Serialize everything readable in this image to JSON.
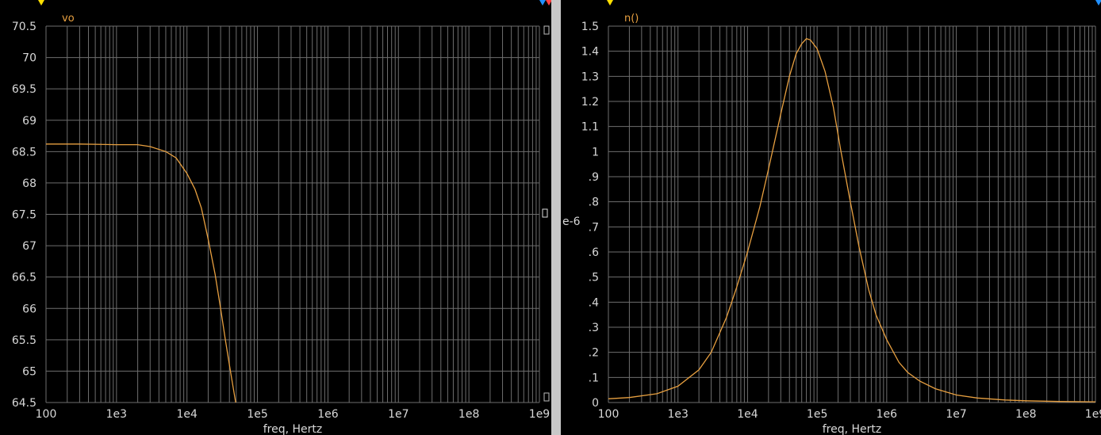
{
  "colors": {
    "background": "#000000",
    "grid": "#6e6e6e",
    "tick_text": "#d8d8d8",
    "trace": "#e8a040",
    "trace_label": "#e8a040",
    "marker_yellow": "#ffe000",
    "marker_blue": "#2090ff",
    "marker_red": "#ff4040"
  },
  "chart_data": [
    {
      "type": "line",
      "title": "",
      "trace_label": "vo",
      "xlabel": "freq, Hertz",
      "ylabel": "",
      "x_scale": "log",
      "xlim": [
        100,
        1000000000
      ],
      "ylim": [
        64.5,
        70.5
      ],
      "grid": true,
      "x_ticks": [
        100,
        1000,
        10000,
        100000,
        1000000,
        10000000,
        100000000,
        1000000000
      ],
      "x_tick_labels": [
        "100",
        "1e3",
        "1e4",
        "1e5",
        "1e6",
        "1e7",
        "1e8",
        "1e9"
      ],
      "y_ticks": [
        70.5,
        70,
        69.5,
        69,
        68.5,
        68,
        67.5,
        67,
        66.5,
        66,
        65.5,
        65,
        64.5
      ],
      "y_tick_labels": [
        "70.5",
        "70",
        "69.5",
        "69",
        "68.5",
        "68",
        "67.5",
        "67",
        "66.5",
        "66",
        "65.5",
        "65",
        "64.5"
      ],
      "series": [
        {
          "x": [
            100,
            300,
            1000,
            2000,
            3000,
            5000,
            7000,
            10000,
            13000,
            16000,
            20000,
            25000,
            30000,
            35000,
            40000,
            45000,
            50000
          ],
          "y": [
            68.62,
            68.62,
            68.61,
            68.61,
            68.58,
            68.5,
            68.4,
            68.15,
            67.9,
            67.6,
            67.1,
            66.55,
            66.0,
            65.5,
            65.1,
            64.75,
            64.45
          ]
        }
      ]
    },
    {
      "type": "line",
      "title": "",
      "trace_label": "n()",
      "xlabel": "freq, Hertz",
      "ylabel": "",
      "y_multiplier": "e-6",
      "x_scale": "log",
      "xlim": [
        100,
        1000000000
      ],
      "ylim": [
        0,
        1.5
      ],
      "grid": true,
      "x_ticks": [
        100,
        1000,
        10000,
        100000,
        1000000,
        10000000,
        100000000,
        1000000000
      ],
      "x_tick_labels": [
        "100",
        "1e3",
        "1e4",
        "1e5",
        "1e6",
        "1e7",
        "1e8",
        "1e9"
      ],
      "y_ticks": [
        1.5,
        1.4,
        1.3,
        1.2,
        1.1,
        1.0,
        0.9,
        0.8,
        0.7,
        0.6,
        0.5,
        0.4,
        0.3,
        0.2,
        0.1,
        0
      ],
      "y_tick_labels": [
        "1.5",
        "1.4",
        "1.3",
        "1.2",
        "1.1",
        "1",
        ".9",
        ".8",
        ".7",
        ".6",
        ".5",
        ".4",
        ".3",
        ".2",
        ".1",
        "0"
      ],
      "series": [
        {
          "x": [
            100,
            200,
            500,
            1000,
            2000,
            3000,
            5000,
            7000,
            10000,
            15000,
            20000,
            30000,
            40000,
            50000,
            60000,
            70000,
            80000,
            100000,
            130000,
            170000,
            220000,
            300000,
            400000,
            550000,
            700000,
            1000000,
            1500000,
            2000000,
            3000000,
            5000000,
            10000000,
            20000000,
            50000000,
            100000000,
            300000000,
            1000000000
          ],
          "y": [
            0.015,
            0.02,
            0.035,
            0.065,
            0.13,
            0.2,
            0.34,
            0.46,
            0.6,
            0.78,
            0.93,
            1.15,
            1.3,
            1.39,
            1.43,
            1.45,
            1.445,
            1.41,
            1.32,
            1.18,
            1.0,
            0.8,
            0.62,
            0.45,
            0.35,
            0.25,
            0.16,
            0.12,
            0.085,
            0.055,
            0.03,
            0.018,
            0.01,
            0.007,
            0.004,
            0.003
          ]
        }
      ]
    }
  ]
}
